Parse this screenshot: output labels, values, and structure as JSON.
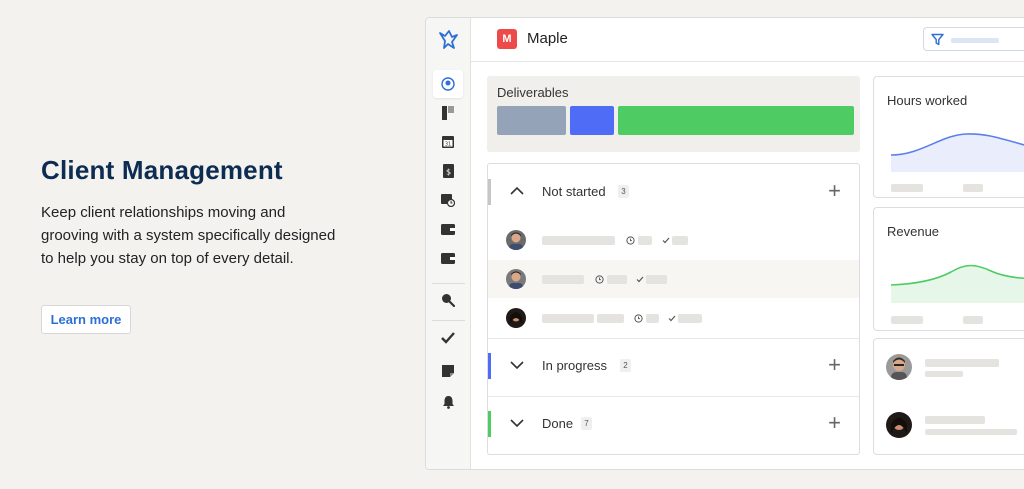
{
  "hero": {
    "title": "Client Management",
    "description": "Keep client relationships moving and grooving with a system specifically designed to help you stay on top of every detail.",
    "cta_label": "Learn more"
  },
  "app": {
    "client_initial": "M",
    "client_name": "Maple",
    "deliverables": {
      "title": "Deliverables",
      "segment_colors": [
        "#94a3b8",
        "#4f6cf7",
        "#4ecb62"
      ]
    },
    "groups": [
      {
        "label": "Not started",
        "count": "3",
        "color": "#c6c6c6",
        "chevron": "up"
      },
      {
        "label": "In progress",
        "count": "2",
        "color": "#4f6cf7",
        "chevron": "down"
      },
      {
        "label": "Done",
        "count": "7",
        "color": "#4ecb62",
        "chevron": "down"
      }
    ],
    "cards": {
      "hours_title": "Hours worked",
      "revenue_title": "Revenue"
    },
    "colors": {
      "accent": "#2c6fd6",
      "hours_line": "#5b7fe8",
      "revenue_line": "#4ecb62",
      "badge": "#ef4a4a"
    }
  }
}
